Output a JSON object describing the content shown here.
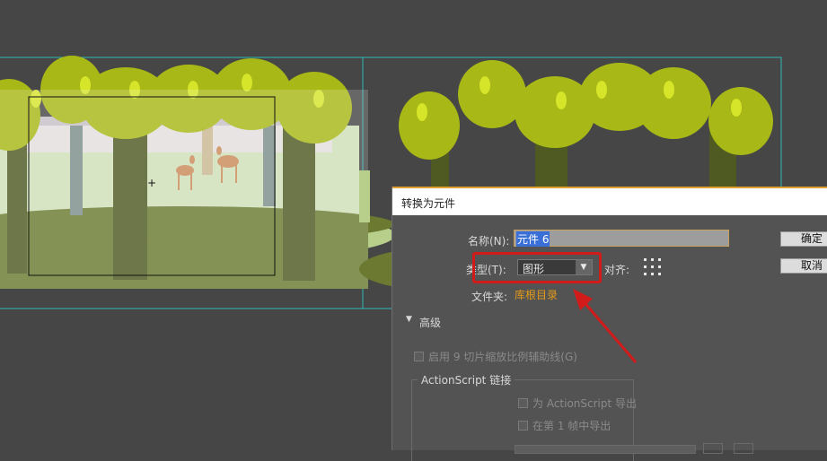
{
  "dialog": {
    "title": "转换为元件",
    "name_label": "名称(N):",
    "name_value": "元件 6",
    "type_label": "类型(T):",
    "type_value": "图形",
    "align_label": "对齐:",
    "folder_label": "文件夹:",
    "folder_value": "库根目录",
    "ok_label": "确定",
    "cancel_label": "取消",
    "advanced_label": "高级",
    "enable_9slice_label": "启用 9 切片缩放比例辅助线(G)",
    "actionscript_group": "ActionScript 链接",
    "export_as_label": "为 ActionScript 导出",
    "export_frame1_label": "在第 1 帧中导出"
  },
  "colors": {
    "highlight": "#d11a1a",
    "folder_link": "#e39a18",
    "canvas_bg": "#464646"
  }
}
